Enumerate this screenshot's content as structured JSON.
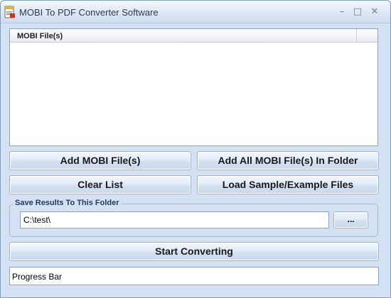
{
  "window": {
    "title": "MOBI To PDF Converter Software",
    "icon": "app-pdf-icon",
    "controls": {
      "minimize": "–",
      "maximize": "□",
      "close": "✕"
    }
  },
  "file_list": {
    "columns": [
      "MOBI File(s)"
    ],
    "rows": []
  },
  "buttons": {
    "add_files": "Add MOBI File(s)",
    "add_folder": "Add All MOBI File(s) In Folder",
    "clear_list": "Clear List",
    "load_samples": "Load Sample/Example Files",
    "browse": "...",
    "start": "Start Converting"
  },
  "output": {
    "group_label": "Save Results To This Folder",
    "folder_value": "C:\\test\\"
  },
  "progress": {
    "label": "Progress Bar",
    "value": 0
  },
  "colors": {
    "window_bg": "#d4e1f2",
    "border": "#8da2c2"
  }
}
